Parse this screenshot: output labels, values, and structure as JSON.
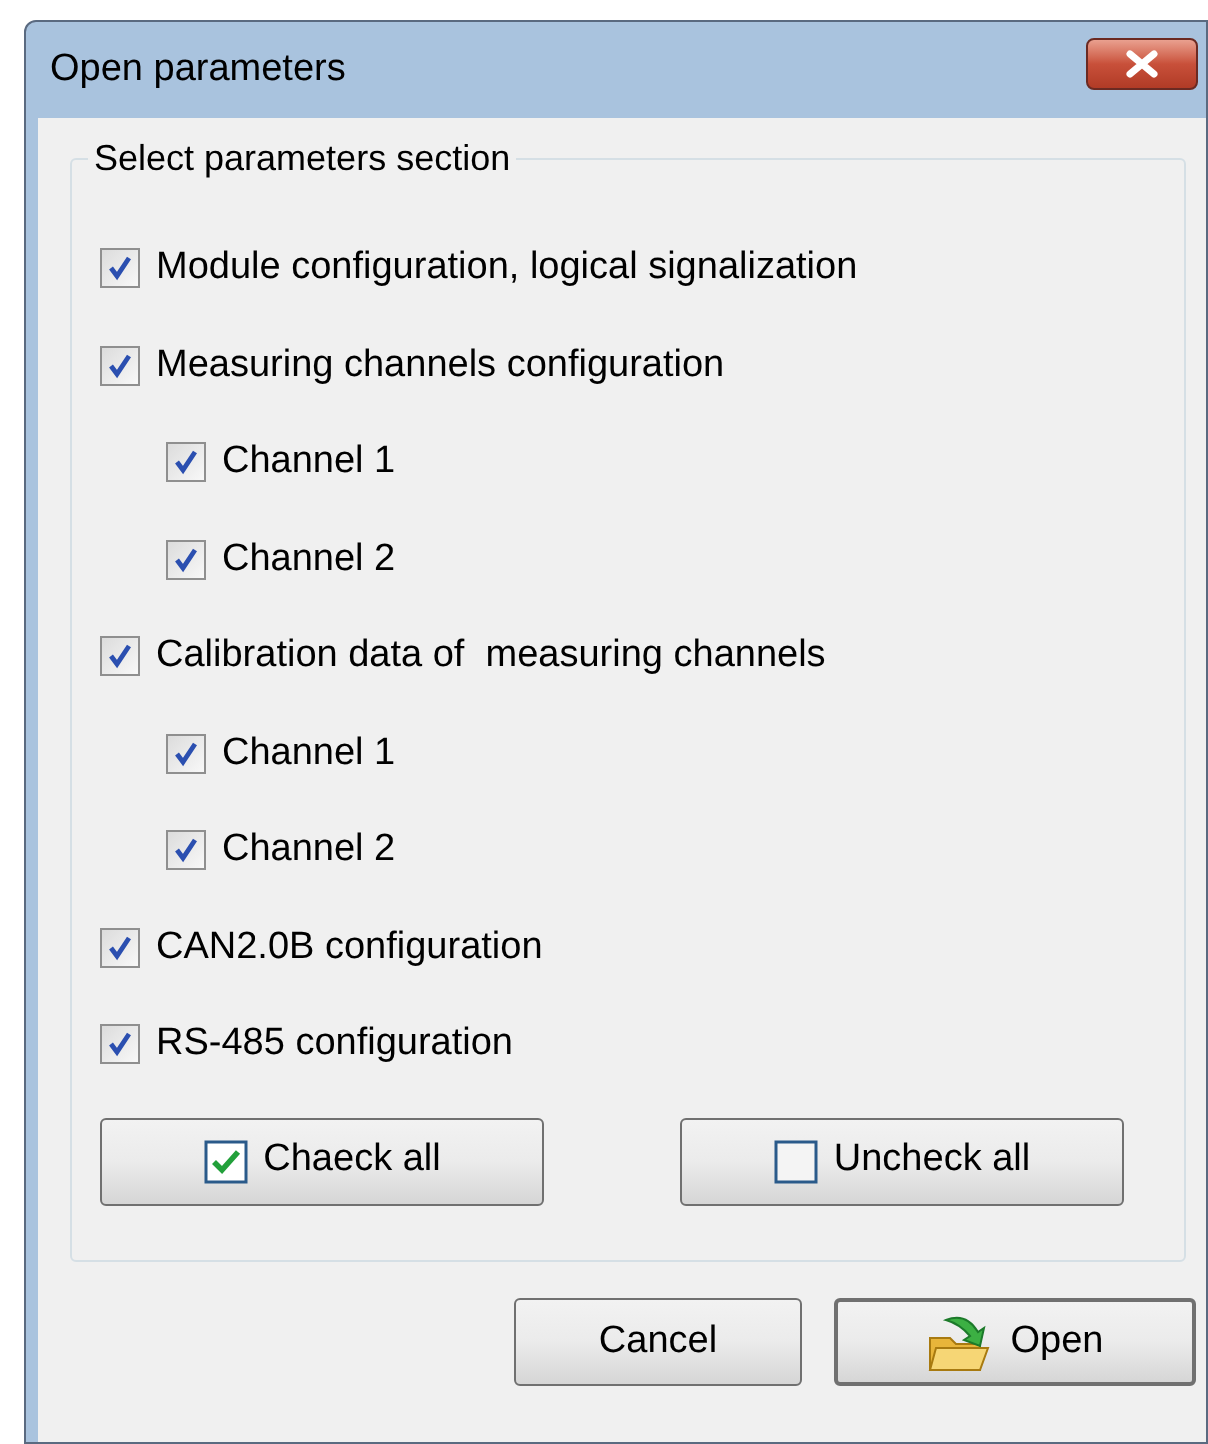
{
  "window": {
    "title": "Open parameters"
  },
  "group": {
    "legend": "Select parameters section",
    "items": [
      {
        "label": "Module configuration, logical signalization",
        "checked": true
      },
      {
        "label": "Measuring channels configuration",
        "checked": true,
        "children": [
          {
            "label": "Channel 1",
            "checked": true
          },
          {
            "label": "Channel 2",
            "checked": true
          }
        ]
      },
      {
        "label": "Calibration data of  measuring channels",
        "checked": true,
        "children": [
          {
            "label": "Channel 1",
            "checked": true
          },
          {
            "label": "Channel 2",
            "checked": true
          }
        ]
      },
      {
        "label": "CAN2.0B configuration",
        "checked": true
      },
      {
        "label": "RS-485 configuration",
        "checked": true
      }
    ],
    "buttons": [
      {
        "label": "Chaeck all",
        "kind": "check"
      },
      {
        "label": "Uncheck all",
        "kind": "uncheck"
      }
    ]
  },
  "footer_buttons": [
    {
      "label": "Cancel",
      "kind": "plain",
      "default": false
    },
    {
      "label": "Open",
      "kind": "open",
      "default": true
    }
  ]
}
